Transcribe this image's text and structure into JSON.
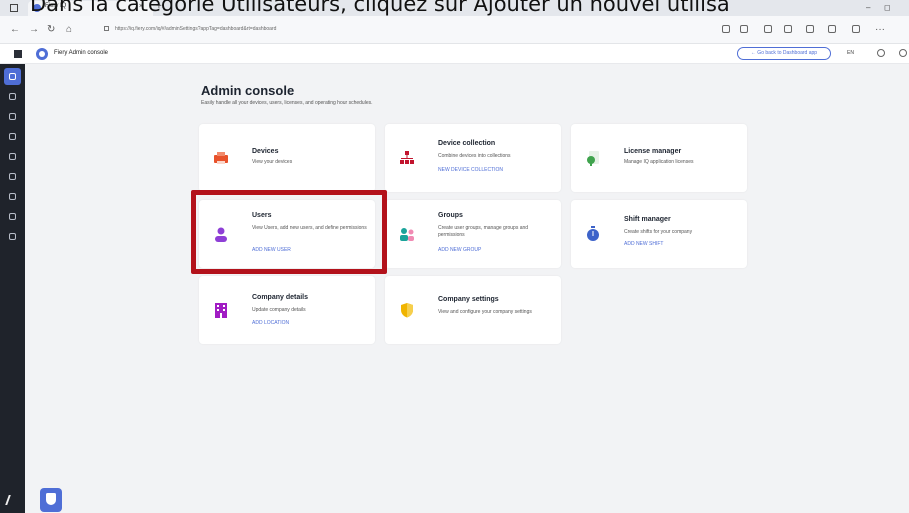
{
  "caption": "Dans la catégorie Utilisateurs, cliquez sur Ajouter un nouvel utilisa",
  "browser": {
    "tab_title": "Fiery IQ",
    "tab_close": "×",
    "new_tab": "+",
    "url": "https://iq.fiery.com/iq/#/adminSettings?appTag=dashboard&rt=dashboard",
    "window_controls": [
      "–",
      "◻"
    ]
  },
  "app": {
    "title": "Fiery Admin console",
    "back_button": "← Go back to Dashboard app",
    "language": "EN"
  },
  "page": {
    "heading": "Admin console",
    "subheading": "Easily handle all your devices, users, licenses, and operating hour schedules."
  },
  "cards": [
    {
      "title": "Devices",
      "desc": "View your devices",
      "link": "",
      "icon": "printer-icon",
      "color": "#e8522b"
    },
    {
      "title": "Device collection",
      "desc": "Combine devices into collections",
      "link": "NEW DEVICE COLLECTION",
      "icon": "device-collection-icon",
      "color": "#c2142e"
    },
    {
      "title": "License manager",
      "desc": "Manage IQ application licenses",
      "link": "",
      "icon": "license-icon",
      "color": "#3fa34d"
    },
    {
      "title": "Users",
      "desc": "View Users, add new users, and define permissions",
      "link": "ADD NEW USER",
      "icon": "user-icon",
      "color": "#8e3fd6"
    },
    {
      "title": "Groups",
      "desc": "Create user groups, manage groups and permissions",
      "link": "ADD NEW GROUP",
      "icon": "groups-icon",
      "color": "#1aa39a"
    },
    {
      "title": "Shift manager",
      "desc": "Create shifts for your company",
      "link": "ADD NEW SHIFT",
      "icon": "stopwatch-icon",
      "color": "#3d63c9"
    },
    {
      "title": "Company details",
      "desc": "Update company details",
      "link": "ADD LOCATION",
      "icon": "building-icon",
      "color": "#a11cc4"
    },
    {
      "title": "Company settings",
      "desc": "View and configure your company settings",
      "link": "",
      "icon": "shield-settings-icon",
      "color": "#f0b400"
    }
  ],
  "colors": {
    "accent": "#4f6ed6",
    "highlight": "#b3121b",
    "sidebar": "#1f232b"
  }
}
